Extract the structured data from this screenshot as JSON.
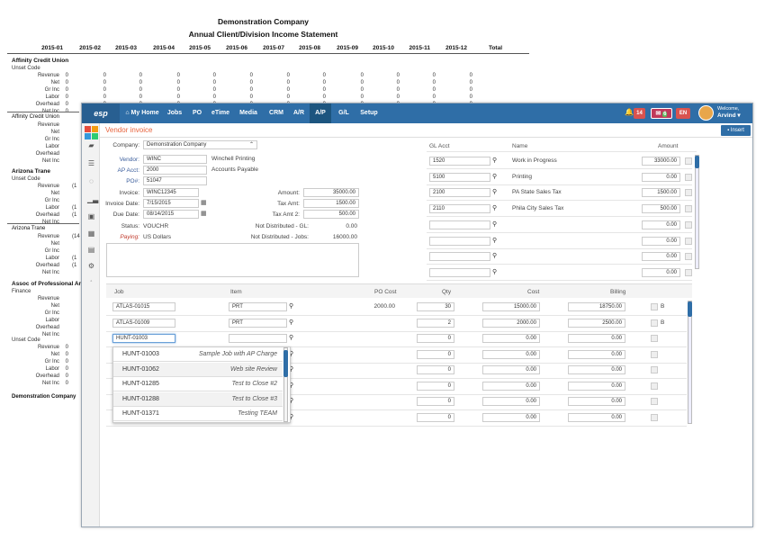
{
  "report": {
    "company": "Demonstration Company",
    "title": "Annual Client/Division Income Statement",
    "months": [
      "2015-01",
      "2015-02",
      "2015-03",
      "2015-04",
      "2015-05",
      "2015-06",
      "2015-07",
      "2015-08",
      "2015-09",
      "2015-10",
      "2015-11",
      "2015-12",
      "Total"
    ],
    "row_labels": [
      "Revenue",
      "Net",
      "Gr Inc",
      "Labor",
      "Overhead",
      "Net Inc"
    ],
    "zero": "0",
    "sections": [
      {
        "name": "Affinity Credit Union",
        "sub": "Unset Code"
      },
      {
        "name": "Affinity Credit Union",
        "sub": ""
      },
      {
        "name": "Arizona Trane",
        "sub": "Unset Code"
      },
      {
        "name": "Arizona Trane",
        "sub": ""
      },
      {
        "name": "Assoc of Professional Ar",
        "sub": "Finance"
      },
      {
        "name": "",
        "sub": "Unset Code"
      }
    ],
    "partial_values": [
      "(1",
      "(1",
      "(1",
      "(14",
      "(1",
      "(1",
      "(1",
      "(14"
    ],
    "footer": "Demonstration Company"
  },
  "nav": {
    "brand": "esp",
    "links": [
      "My Home",
      "Jobs",
      "PO",
      "eTime",
      "Media",
      "CRM",
      "A/R",
      "A/P",
      "G/L",
      "Setup"
    ],
    "active": "A/P",
    "badge_alerts": "14",
    "badge_mail": "6",
    "badge_lang": "EN",
    "welcome": "Welcome,",
    "user": "Arvind"
  },
  "page": {
    "title": "Vendor invoice",
    "insert": "Insert"
  },
  "form": {
    "company_label": "Company:",
    "company_value": "Demonstration Company",
    "vendor_label": "Vendor:",
    "vendor_value": "WINC",
    "vendor_name": "Winchell Printing",
    "apacct_label": "AP Acct:",
    "apacct_value": "2000",
    "apacct_name": "Accounts Payable",
    "po_label": "PO#:",
    "po_value": "51047",
    "invoice_label": "Invoice:",
    "invoice_value": "WINC12345",
    "invdate_label": "Invoice Date:",
    "invdate_value": "7/15/2015",
    "duedate_label": "Due Date:",
    "duedate_value": "08/14/2015",
    "status_label": "Status:",
    "status_value": "VOUCHR",
    "paying_label": "Paying:",
    "paying_value": "US Dollars",
    "amount_label": "Amount:",
    "amount_value": "35000.00",
    "taxamt_label": "Tax Amt:",
    "taxamt_value": "1500.00",
    "taxamt2_label": "Tax Amt 2:",
    "taxamt2_value": "500.00",
    "nd_gl_label": "Not Distributed - GL:",
    "nd_gl_value": "0.00",
    "nd_jobs_label": "Not Distributed - Jobs:",
    "nd_jobs_value": "16000.00"
  },
  "gl": {
    "headers": [
      "GL Acct",
      "Name",
      "Amount"
    ],
    "rows": [
      {
        "acct": "1520",
        "name": "Work in Progress",
        "amount": "33000.00"
      },
      {
        "acct": "5100",
        "name": "Printing",
        "amount": "0.00"
      },
      {
        "acct": "2100",
        "name": "PA State Sales Tax",
        "amount": "1500.00"
      },
      {
        "acct": "2110",
        "name": "Phila City Sales Tax",
        "amount": "500.00"
      },
      {
        "acct": "",
        "name": "",
        "amount": "0.00"
      },
      {
        "acct": "",
        "name": "",
        "amount": "0.00"
      },
      {
        "acct": "",
        "name": "",
        "amount": "0.00"
      },
      {
        "acct": "",
        "name": "",
        "amount": "0.00"
      }
    ]
  },
  "jobs": {
    "headers": [
      "Job",
      "Item",
      "PO Cost",
      "Qty",
      "Cost",
      "Billing"
    ],
    "rows": [
      {
        "job": "ATLAS-01015",
        "item": "PRT",
        "pocost": "2000.00",
        "qty": "30",
        "cost": "15000.00",
        "billing": "18750.00",
        "flag": "B"
      },
      {
        "job": "ATLAS-01009",
        "item": "PRT",
        "pocost": "",
        "qty": "2",
        "cost": "2000.00",
        "billing": "2500.00",
        "flag": "B"
      },
      {
        "job": "HUNT-01003",
        "item": "",
        "pocost": "",
        "qty": "0",
        "cost": "0.00",
        "billing": "0.00",
        "flag": ""
      },
      {
        "job": "",
        "item": "",
        "pocost": "",
        "qty": "0",
        "cost": "0.00",
        "billing": "0.00",
        "flag": ""
      },
      {
        "job": "",
        "item": "",
        "pocost": "",
        "qty": "0",
        "cost": "0.00",
        "billing": "0.00",
        "flag": ""
      },
      {
        "job": "",
        "item": "",
        "pocost": "",
        "qty": "0",
        "cost": "0.00",
        "billing": "0.00",
        "flag": ""
      },
      {
        "job": "",
        "item": "",
        "pocost": "",
        "qty": "0",
        "cost": "0.00",
        "billing": "0.00",
        "flag": ""
      },
      {
        "job": "",
        "item": "",
        "pocost": "",
        "qty": "0",
        "cost": "0.00",
        "billing": "0.00",
        "flag": ""
      }
    ]
  },
  "dropdown": [
    {
      "code": "HUNT-01003",
      "desc": "Sample Job with AP Charge"
    },
    {
      "code": "HUNT-01062",
      "desc": "Web site Review"
    },
    {
      "code": "HUNT-01285",
      "desc": "Test to Close #2"
    },
    {
      "code": "HUNT-01288",
      "desc": "Test to Close #3"
    },
    {
      "code": "HUNT-01371",
      "desc": "Testing TEAM"
    }
  ]
}
